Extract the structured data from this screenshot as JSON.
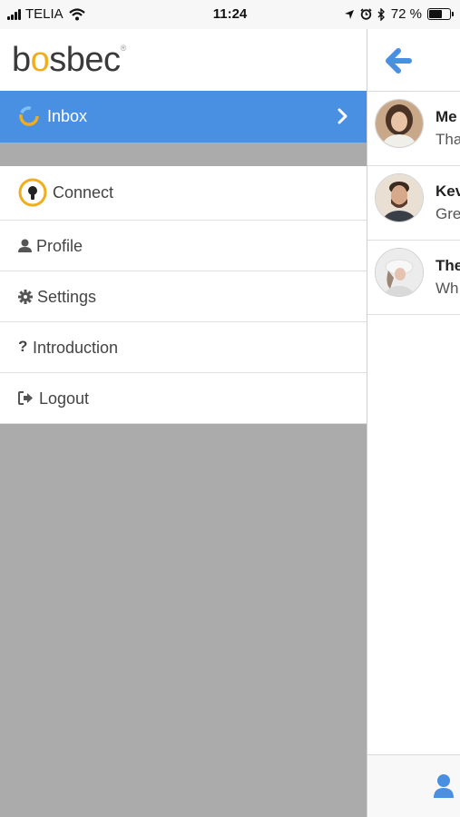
{
  "status_bar": {
    "carrier": "TELIA",
    "time": "11:24",
    "battery_percent": "72 %",
    "battery_level": 0.72
  },
  "app": {
    "logo_text": "bosbec",
    "logo_mark": "®"
  },
  "menu": {
    "active_item": {
      "label": "Inbox",
      "icon": "inbox-ring-icon",
      "chevron": "chevron-right-icon"
    },
    "items": [
      {
        "label": "Connect",
        "icon": "bulb-icon"
      },
      {
        "label": "Profile",
        "icon": "user-icon"
      },
      {
        "label": "Settings",
        "icon": "gear-icon"
      },
      {
        "label": "Introduction",
        "icon": "question-icon"
      },
      {
        "label": "Logout",
        "icon": "logout-icon"
      }
    ]
  },
  "conversations": [
    {
      "name": "Me",
      "preview": "Tha"
    },
    {
      "name": "Kev",
      "preview": "Gre"
    },
    {
      "name": "The",
      "preview": "Wh"
    }
  ],
  "colors": {
    "accent": "#4a90e2",
    "overlay": "#ababab",
    "logo_accent": "#f0ad1e"
  }
}
